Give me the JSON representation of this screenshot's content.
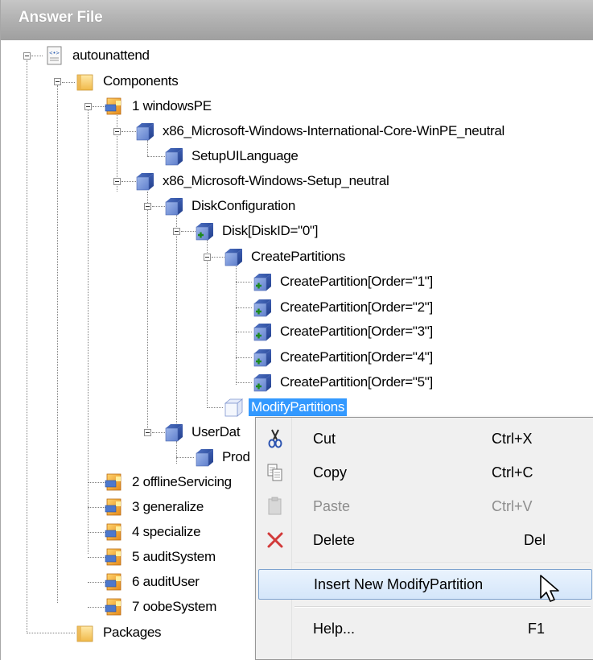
{
  "panel": {
    "title": "Answer File"
  },
  "tree": {
    "root": "autounattend",
    "components": "Components",
    "pass1": "1 windowsPE",
    "intl_core": "x86_Microsoft-Windows-International-Core-WinPE_neutral",
    "setup_ui_language": "SetupUILanguage",
    "setup_neutral": "x86_Microsoft-Windows-Setup_neutral",
    "disk_configuration": "DiskConfiguration",
    "disk": "Disk[DiskID=\"0\"]",
    "create_partitions": "CreatePartitions",
    "create_partition_items": [
      "CreatePartition[Order=\"1\"]",
      "CreatePartition[Order=\"2\"]",
      "CreatePartition[Order=\"3\"]",
      "CreatePartition[Order=\"4\"]",
      "CreatePartition[Order=\"5\"]"
    ],
    "modify_partitions": "ModifyPartitions",
    "user_data": "UserDat",
    "product_key": "Prod",
    "passes": [
      "2 offlineServicing",
      "3 generalize",
      "4 specialize",
      "5 auditSystem",
      "6 auditUser",
      "7 oobeSystem"
    ],
    "packages": "Packages"
  },
  "context_menu": {
    "cut": {
      "label": "Cut",
      "shortcut": "Ctrl+X"
    },
    "copy": {
      "label": "Copy",
      "shortcut": "Ctrl+C"
    },
    "paste": {
      "label": "Paste",
      "shortcut": "Ctrl+V"
    },
    "delete": {
      "label": "Delete",
      "shortcut": "Del"
    },
    "insert": {
      "label": "Insert New ModifyPartition"
    },
    "help": {
      "label": "Help...",
      "shortcut": "F1"
    }
  },
  "colors": {
    "selection": "#3399ff",
    "header_gradient_top": "#c6c6c6",
    "menu_highlight_border": "#7da2ce"
  }
}
